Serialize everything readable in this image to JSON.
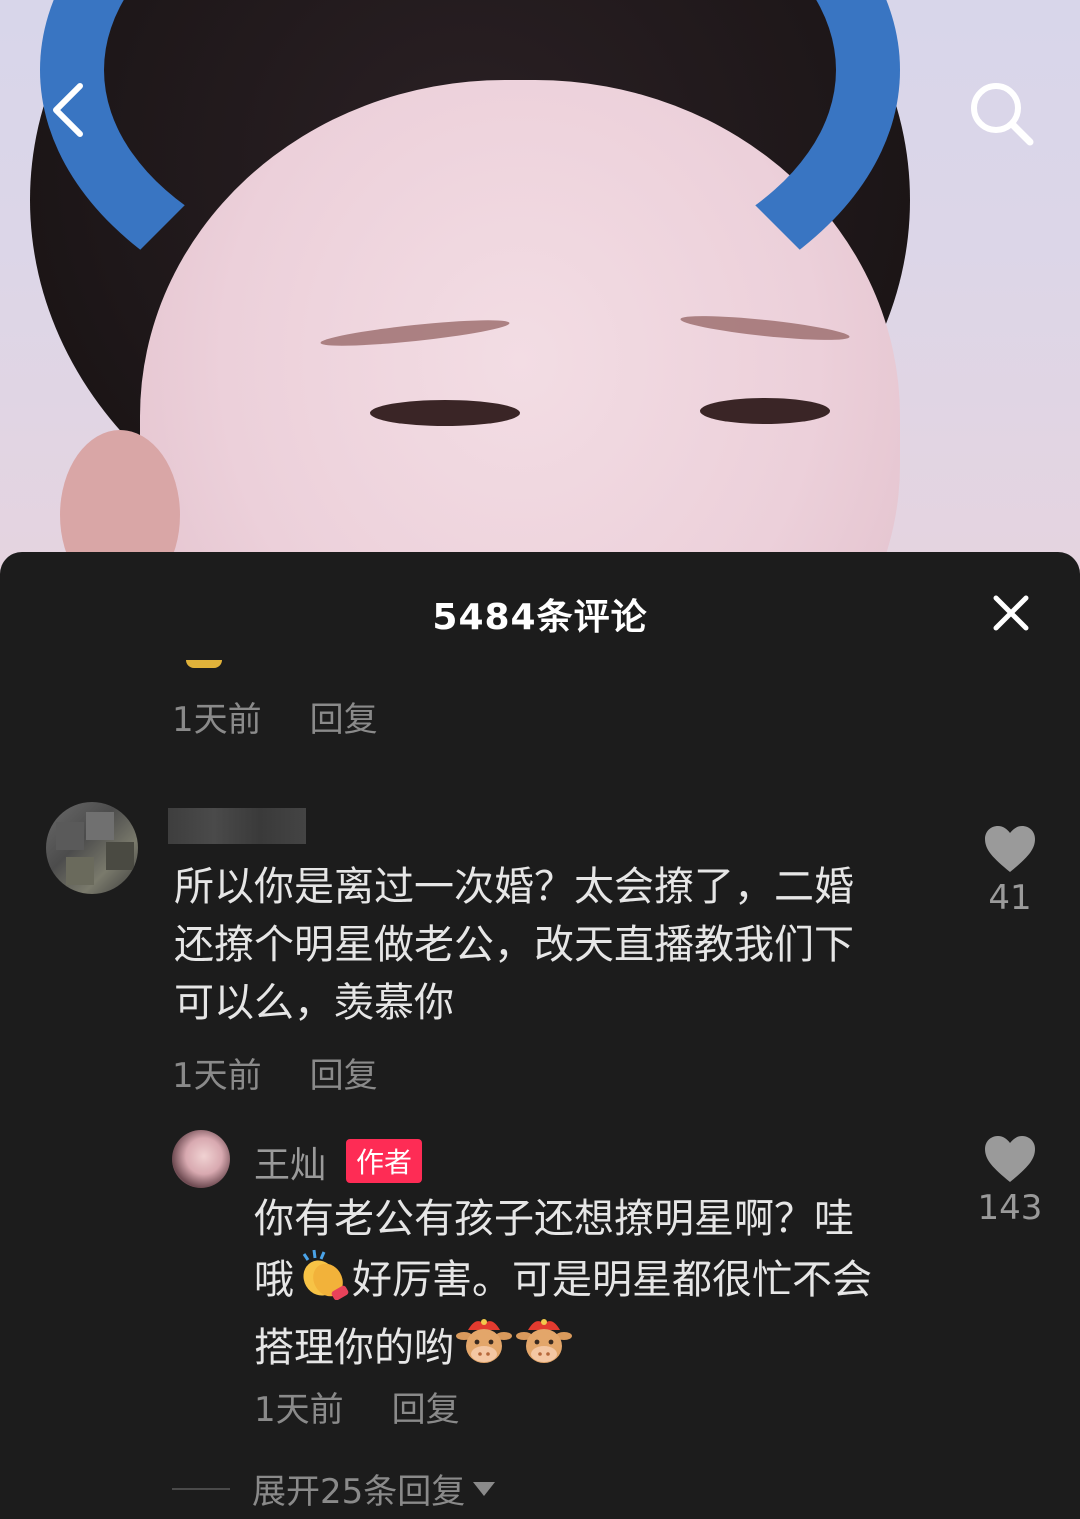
{
  "header": {
    "back_icon": "chevron-left-icon",
    "search_icon": "search-icon"
  },
  "panel": {
    "title": "5484条评论",
    "close_icon": "close-icon"
  },
  "prev_comment": {
    "time": "1天前",
    "reply_label": "回复"
  },
  "comment1": {
    "text_line1": "所以你是离过一次婚？太会撩了，二婚",
    "text_line2": "还撩个明星做老公，改天直播教我们下",
    "text_line3": "可以么，羡慕你",
    "time": "1天前",
    "reply_label": "回复",
    "likes": "41"
  },
  "reply1": {
    "author": "王灿",
    "badge": "作者",
    "text_line1": "你有老公有孩子还想撩明星啊？哇",
    "text_line2a": "哦",
    "text_line2b": "好厉害。可是明星都很忙不会",
    "text_line3": "搭理你的哟",
    "emojis": [
      "clapping-hands-emoji",
      "ox-emoji",
      "ox-emoji"
    ],
    "time": "1天前",
    "reply_label": "回复",
    "likes": "143"
  },
  "expand_label": "展开25条回复",
  "colors": {
    "background": "#1c1c1c",
    "author_badge": "#fe2c55",
    "muted_text": "#8a8a8a",
    "body_text": "#e6e6e6"
  }
}
